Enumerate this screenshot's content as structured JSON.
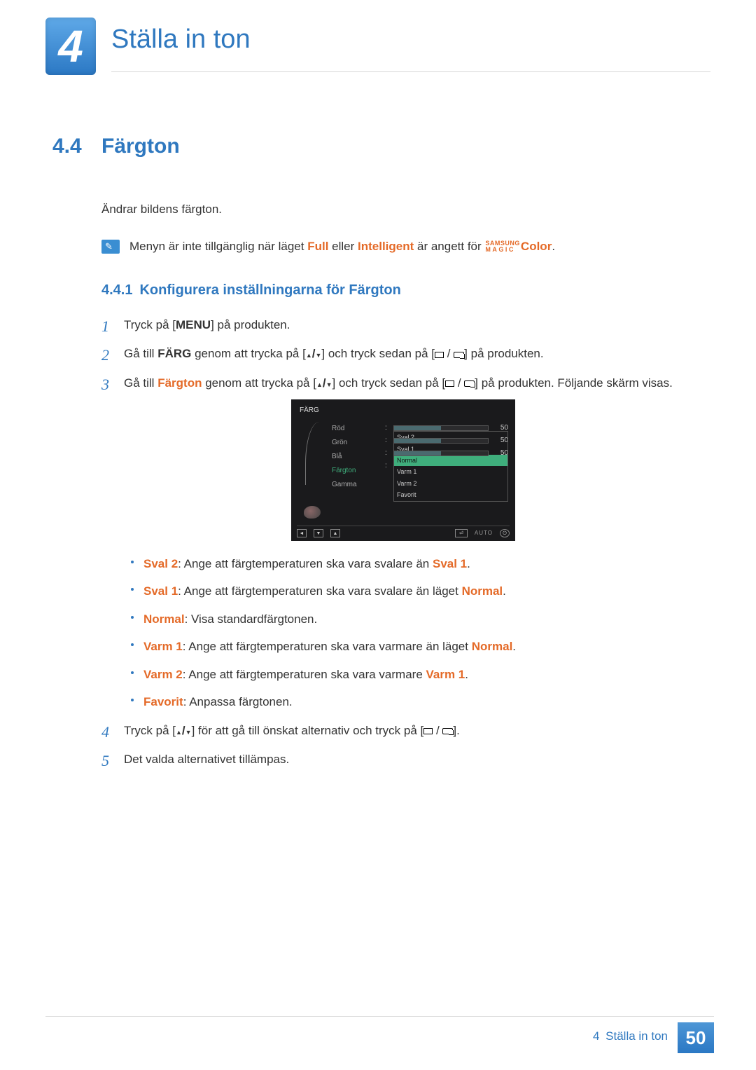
{
  "chapter": {
    "number": "4",
    "title": "Ställa in ton"
  },
  "section": {
    "number": "4.4",
    "title": "Färgton",
    "intro": "Ändrar bildens färgton.",
    "note": {
      "prefix": "Menyn är inte tillgänglig när läget ",
      "mode1": "Full",
      "middle": " eller ",
      "mode2": "Intelligent",
      "after": " är angett för ",
      "magic_top": "SAMSUNG",
      "magic_bot": "MAGIC",
      "magic_suffix": "Color",
      "end": "."
    }
  },
  "subsection": {
    "number": "4.4.1",
    "title": "Konfigurera inställningarna för Färgton"
  },
  "steps": {
    "s1": {
      "a": "Tryck på [",
      "menu": "MENU",
      "b": "] på produkten."
    },
    "s2": {
      "a": "Gå till ",
      "target": "FÄRG",
      "b": " genom att trycka på [",
      "c": "] och tryck sedan på [",
      "d": "] på produkten."
    },
    "s3": {
      "a": "Gå till ",
      "target": "Färgton",
      "b": " genom att trycka på [",
      "c": "] och tryck sedan på [",
      "d": "] på produkten. Följande skärm visas."
    },
    "s4": {
      "a": "Tryck på [",
      "b": "] för att gå till önskat alternativ och tryck på [",
      "c": "]."
    },
    "s5": {
      "text": "Det valda alternativet tillämpas."
    }
  },
  "osd": {
    "title": "FÄRG",
    "rows": [
      {
        "label": "Röd",
        "value": "50"
      },
      {
        "label": "Grön",
        "value": "50"
      },
      {
        "label": "Blå",
        "value": "50"
      }
    ],
    "sel_label": "Färgton",
    "gamma_label": "Gamma",
    "options": [
      "Sval 2",
      "Sval 1",
      "Normal",
      "Varm 1",
      "Varm 2",
      "Favorit"
    ],
    "highlight_index": 2,
    "footer_auto": "AUTO"
  },
  "bullets": [
    {
      "label": "Sval 2",
      "text": ": Ange att färgtemperaturen ska vara svalare än ",
      "ref": "Sval 1",
      "end": "."
    },
    {
      "label": "Sval 1",
      "text": ": Ange att färgtemperaturen ska vara svalare än läget ",
      "ref": "Normal",
      "end": "."
    },
    {
      "label": "Normal",
      "text": ": Visa standardfärgtonen.",
      "ref": "",
      "end": ""
    },
    {
      "label": "Varm 1",
      "text": ": Ange att färgtemperaturen ska vara varmare än läget ",
      "ref": "Normal",
      "end": "."
    },
    {
      "label": "Varm 2",
      "text": ": Ange att färgtemperaturen ska vara varmare ",
      "ref": "Varm 1",
      "end": "."
    },
    {
      "label": "Favorit",
      "text": ": Anpassa färgtonen.",
      "ref": "",
      "end": ""
    }
  ],
  "footer": {
    "chapter_num": "4",
    "chapter_title": "Ställa in ton",
    "page": "50"
  }
}
